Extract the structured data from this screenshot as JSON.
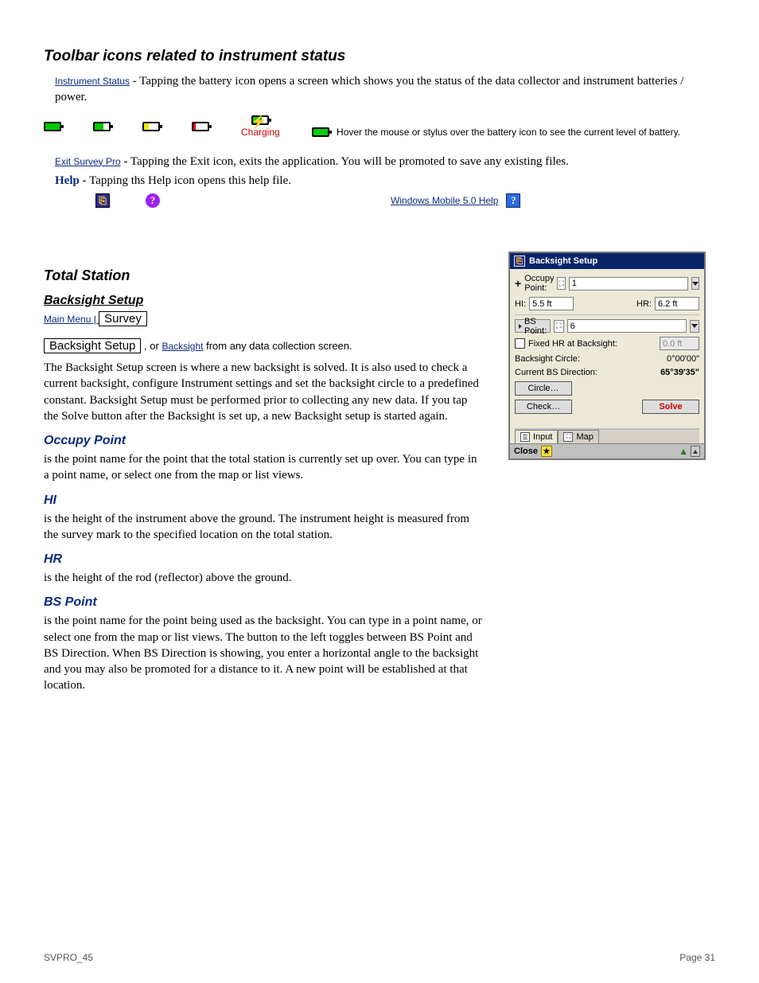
{
  "toolbarIcons": {
    "heading": "Toolbar icons related to instrument status",
    "instrumentStatusLabel": "Instrument Status",
    "instrumentStatusDesc": "- Tapping the battery icon opens a screen which shows you the status of the data collector and instrument batteries / power.",
    "charging": "Charging",
    "exitSurveyLabel": "Exit Survey Pro",
    "exitSurveyDesc": "- Tapping the Exit icon, exits the application. You will be promoted to save any existing files.",
    "helpLabel": "Help",
    "helpDesc": "- Tapping ths Help icon opens this help file.",
    "windowsHelp": "Windows Mobile 5.0 Help"
  },
  "totalStation": {
    "h2": "Total Station",
    "bsHeading": "Backsight Setup",
    "navPrefix": "Main Menu | ",
    "survey": "Survey",
    "bsBtn": "Backsight Setup",
    "or": ", or ",
    "backsightLink": "Backsight",
    "navSuffix": " from any data collection screen.",
    "para": "The Backsight Setup screen is where a new backsight is solved. It is also used to check a current backsight, configure Instrument settings and set the backsight circle to a predefined constant. Backsight Setup must be performed prior to collecting any new data. If you tap the Solve button after the Backsight is set up, a new Backsight setup is started again.",
    "occupyHeading": "Occupy Point",
    "occupyPara": "is the point name for the point that the total station is currently set up over. You can type in a point name, or select one from the map or list views.",
    "hiHeading": "HI",
    "hiPara": "is the height of the instrument above the ground. The instrument height is measured from the survey mark to the specified location on the total station.",
    "hrHeading": "HR",
    "hrPara": "is the height of the rod (reflector) above the ground.",
    "bsptHeading": "BS Point",
    "bsptPara": "is the point name for the point being used as the backsight. You can type in a point name, or select one from the map or list views. The button to the left toggles between BS Point and BS Direction. When BS Direction is showing, you enter a horizontal angle to the backsight and you may also be promoted for a distance to it. A new point will be established at that location."
  },
  "dialog": {
    "title": "Backsight Setup",
    "occupy": "Occupy Point:",
    "occupyVal": "1",
    "hi": "HI:",
    "hiVal": "5.5 ft",
    "hr": "HR:",
    "hrVal": "6.2 ft",
    "bspt": "BS Point:",
    "bsptVal": "6",
    "fixedHR": "Fixed HR at Backsight:",
    "fixedHRVal": "0.0 ft",
    "circleLbl": "Backsight Circle:",
    "circleVal": "0°00'00\"",
    "curDirLbl": "Current BS Direction:",
    "curDirVal": "65°39'35\"",
    "circleBtn": "Circle…",
    "checkBtn": "Check…",
    "solveBtn": "Solve",
    "tabInput": "Input",
    "tabMap": "Map",
    "close": "Close"
  },
  "footer": {
    "left": "SVPRO_45",
    "right": "Page 31"
  }
}
